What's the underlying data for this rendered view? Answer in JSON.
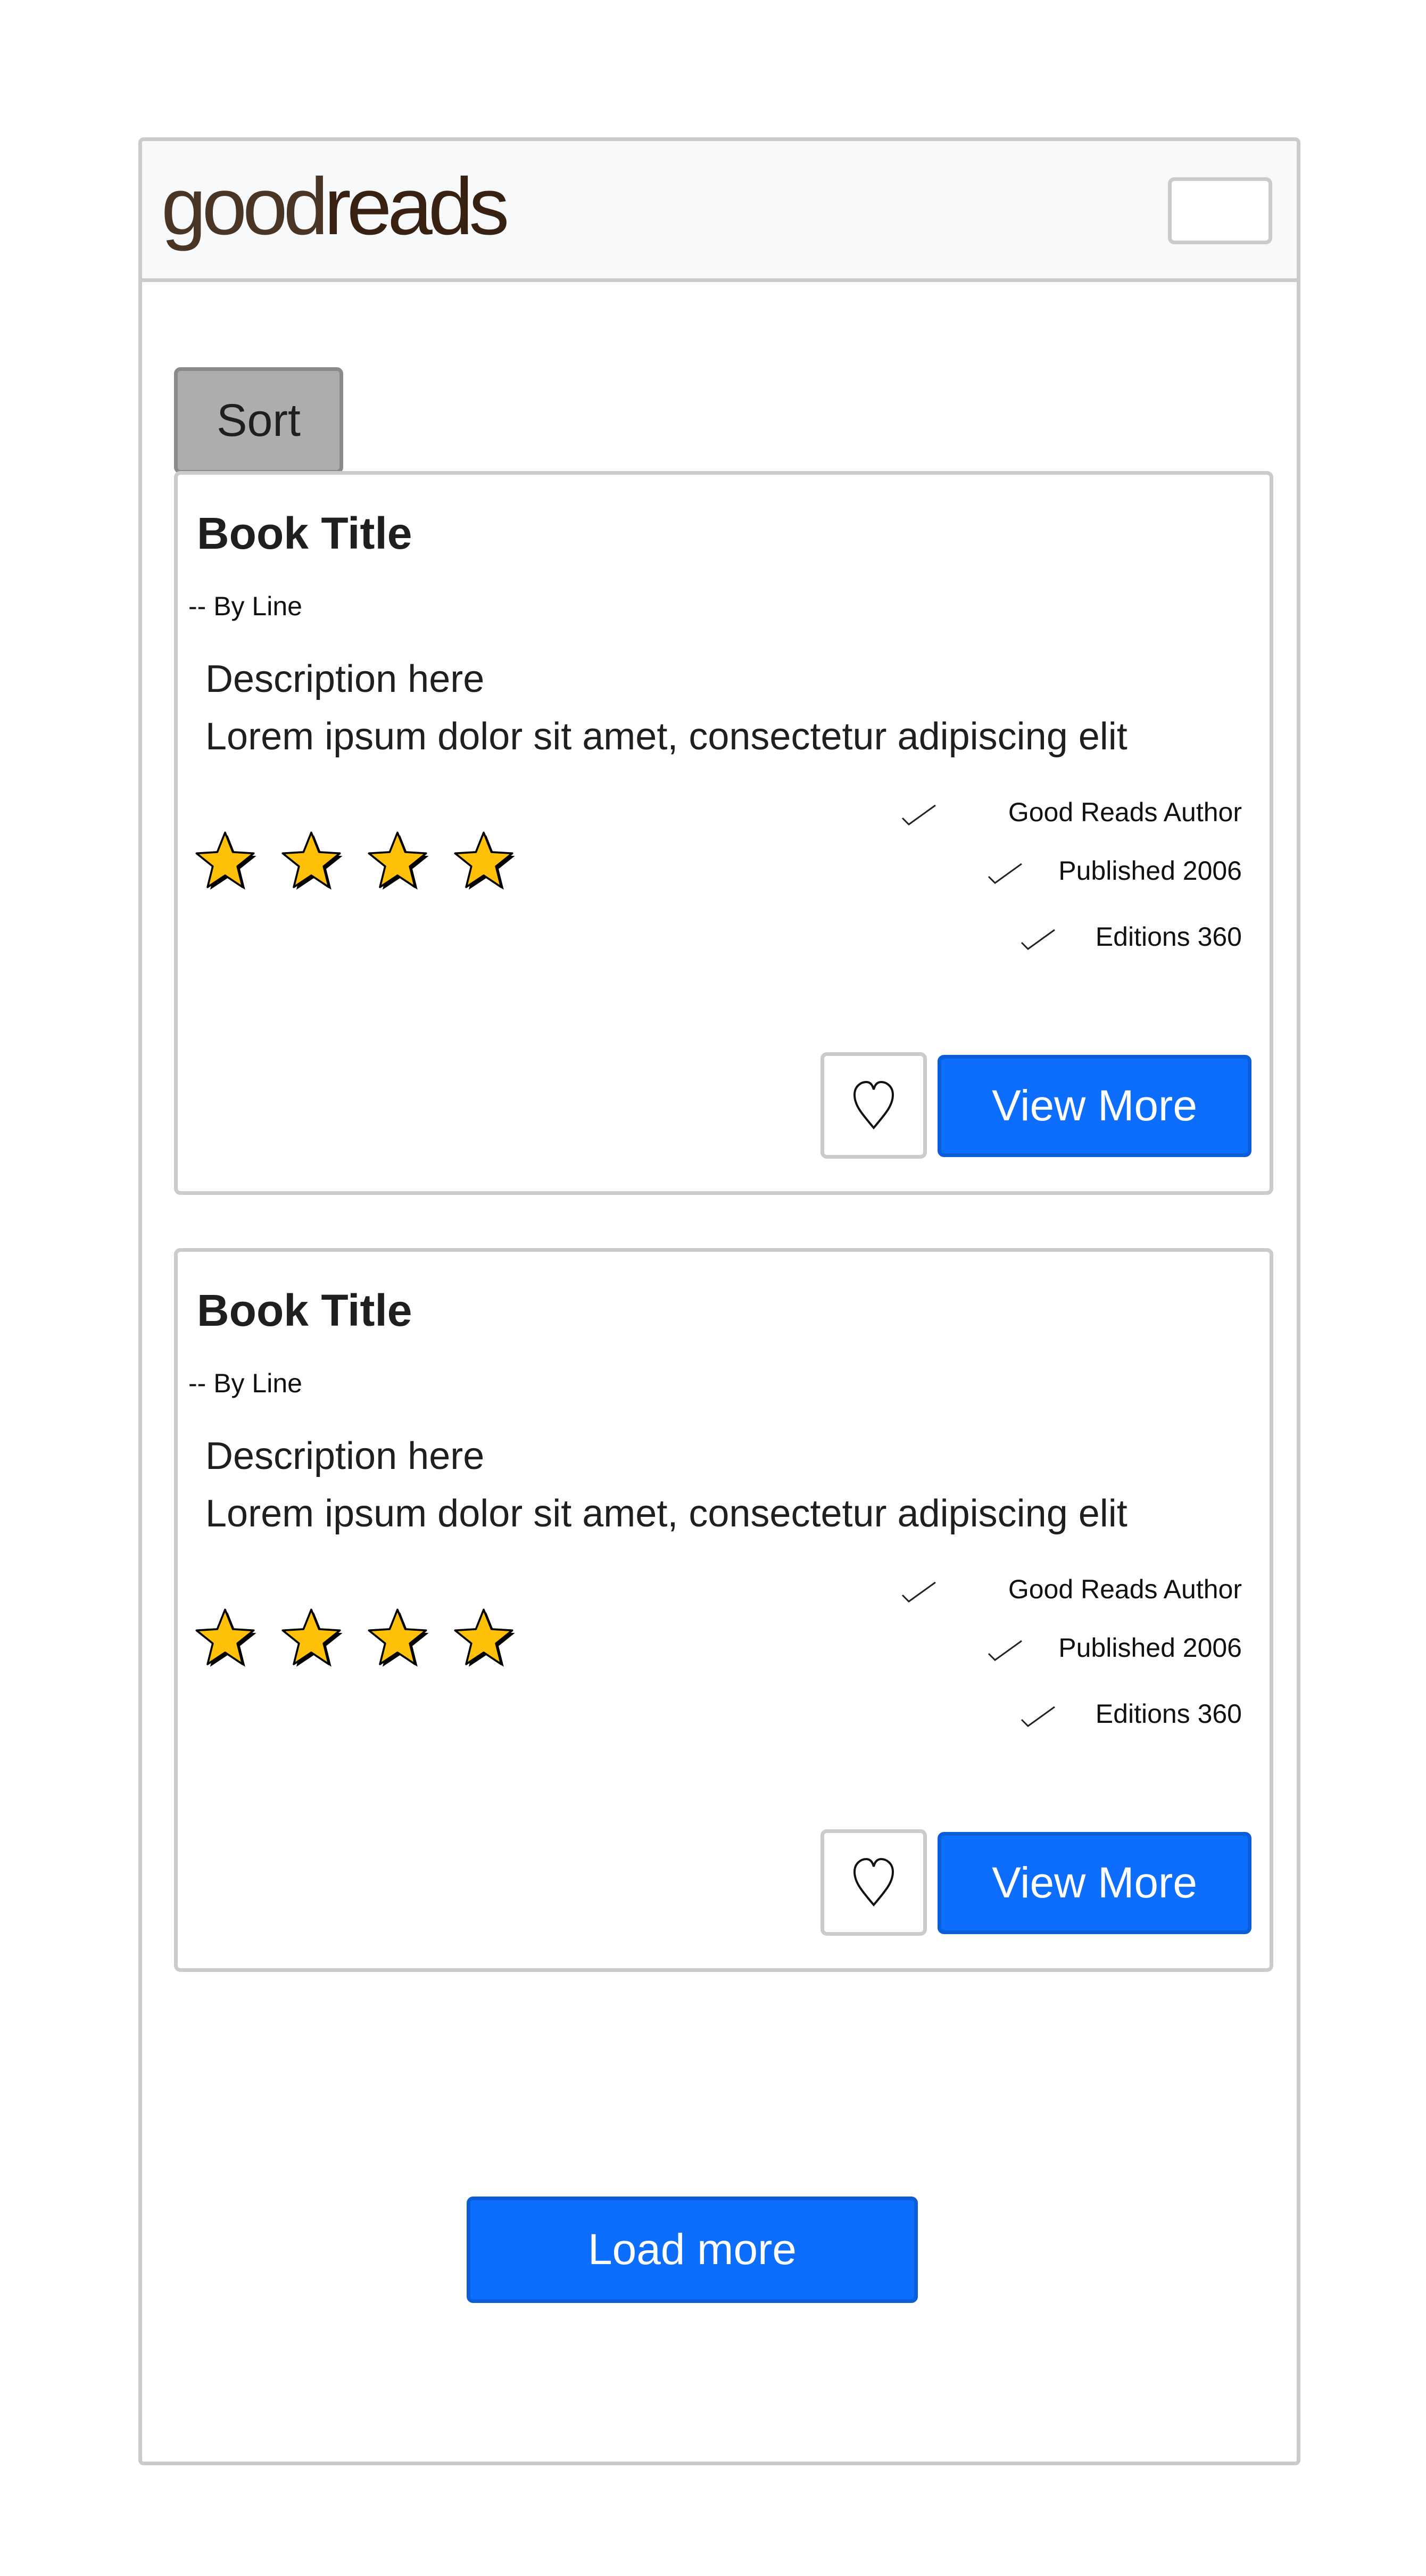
{
  "navbar": {
    "logo_good": "good",
    "logo_reads": "reads",
    "menu_toggle_icon": "hamburger-menu-icon"
  },
  "toolbar": {
    "sort_label": "Sort"
  },
  "cards": [
    {
      "title": "Book Title",
      "byline": "-- By Line",
      "description_heading": "Description here",
      "description_text": "Lorem ipsum dolor sit amet, consectetur adipiscing elit",
      "rating_stars": 4,
      "meta": [
        "Good Reads Author",
        "Published 2006",
        "Editions 360"
      ],
      "favorite_icon": "heart-icon",
      "view_more_label": "View More"
    },
    {
      "title": "Book Title",
      "byline": "-- By Line",
      "description_heading": "Description here",
      "description_text": "Lorem ipsum dolor sit amet, consectetur adipiscing elit",
      "rating_stars": 4,
      "meta": [
        "Good Reads Author",
        "Published 2006",
        "Editions 360"
      ],
      "favorite_icon": "heart-icon",
      "view_more_label": "View More"
    }
  ],
  "footer": {
    "load_more_label": "Load more"
  },
  "colors": {
    "primary": "#0d6efd",
    "star": "#ffc107",
    "border": "#cbcbcb",
    "sort_bg": "#adadad",
    "navbar_bg": "#f8f9fa",
    "logo": "#382110"
  }
}
